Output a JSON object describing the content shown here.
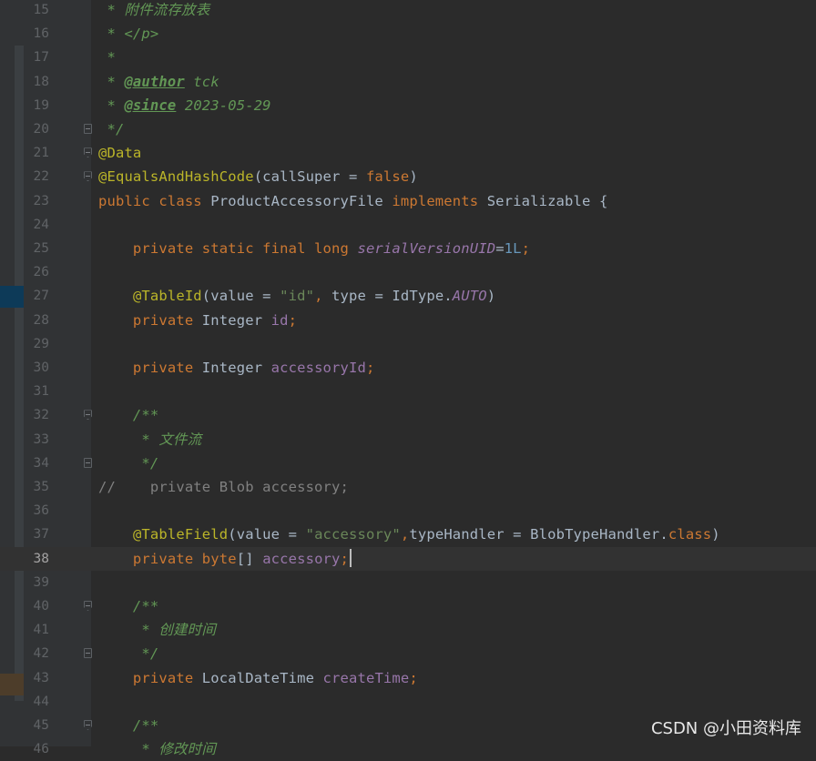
{
  "editor": {
    "watermark": "CSDN @小田资料库",
    "lines": [
      {
        "num": "15",
        "fold": "",
        "segs": [
          {
            "t": " * 附件流存放表",
            "c": "dc"
          }
        ]
      },
      {
        "num": "16",
        "fold": "",
        "segs": [
          {
            "t": " * </p>",
            "c": "dc"
          }
        ]
      },
      {
        "num": "17",
        "fold": "",
        "segs": [
          {
            "t": " *",
            "c": "dc"
          }
        ]
      },
      {
        "num": "18",
        "fold": "",
        "segs": [
          {
            "t": " * ",
            "c": "dc"
          },
          {
            "t": "@author",
            "c": "dt"
          },
          {
            "t": " tck",
            "c": "dc"
          }
        ]
      },
      {
        "num": "19",
        "fold": "",
        "segs": [
          {
            "t": " * ",
            "c": "dc"
          },
          {
            "t": "@since",
            "c": "dt"
          },
          {
            "t": " 2023-05-29",
            "c": "dc"
          }
        ]
      },
      {
        "num": "20",
        "fold": "end",
        "segs": [
          {
            "t": " */",
            "c": "dc"
          }
        ]
      },
      {
        "num": "21",
        "fold": "open",
        "segs": [
          {
            "t": "@Data",
            "c": "a"
          }
        ]
      },
      {
        "num": "22",
        "fold": "open",
        "segs": [
          {
            "t": "@EqualsAndHashCode",
            "c": "a"
          },
          {
            "t": "(callSuper = ",
            "c": ""
          },
          {
            "t": "false",
            "c": "k"
          },
          {
            "t": ")",
            "c": ""
          }
        ]
      },
      {
        "num": "23",
        "fold": "",
        "segs": [
          {
            "t": "public class ",
            "c": "k"
          },
          {
            "t": "ProductAccessoryFile ",
            "c": ""
          },
          {
            "t": "implements ",
            "c": "k"
          },
          {
            "t": "Serializable {",
            "c": ""
          }
        ]
      },
      {
        "num": "24",
        "fold": "",
        "segs": []
      },
      {
        "num": "25",
        "fold": "",
        "segs": [
          {
            "t": "    private static final long ",
            "c": "k"
          },
          {
            "t": "serialVersionUID",
            "c": "fi"
          },
          {
            "t": "=",
            "c": ""
          },
          {
            "t": "1L",
            "c": "n"
          },
          {
            "t": ";",
            "c": "k"
          }
        ]
      },
      {
        "num": "26",
        "fold": "",
        "segs": []
      },
      {
        "num": "27",
        "fold": "",
        "segs": [
          {
            "t": "    ",
            "c": ""
          },
          {
            "t": "@TableId",
            "c": "a"
          },
          {
            "t": "(value = ",
            "c": ""
          },
          {
            "t": "\"id\"",
            "c": "s"
          },
          {
            "t": ", ",
            "c": "k"
          },
          {
            "t": "type = IdType.",
            "c": ""
          },
          {
            "t": "AUTO",
            "c": "fi"
          },
          {
            "t": ")",
            "c": ""
          }
        ]
      },
      {
        "num": "28",
        "fold": "",
        "segs": [
          {
            "t": "    private ",
            "c": "k"
          },
          {
            "t": "Integer ",
            "c": ""
          },
          {
            "t": "id",
            "c": "f"
          },
          {
            "t": ";",
            "c": "k"
          }
        ]
      },
      {
        "num": "29",
        "fold": "",
        "segs": []
      },
      {
        "num": "30",
        "fold": "",
        "segs": [
          {
            "t": "    private ",
            "c": "k"
          },
          {
            "t": "Integer ",
            "c": ""
          },
          {
            "t": "accessoryId",
            "c": "f"
          },
          {
            "t": ";",
            "c": "k"
          }
        ]
      },
      {
        "num": "31",
        "fold": "",
        "segs": []
      },
      {
        "num": "32",
        "fold": "open",
        "segs": [
          {
            "t": "    /**",
            "c": "dc"
          }
        ]
      },
      {
        "num": "33",
        "fold": "",
        "segs": [
          {
            "t": "     * 文件流",
            "c": "dc"
          }
        ]
      },
      {
        "num": "34",
        "fold": "end",
        "segs": [
          {
            "t": "     */",
            "c": "dc"
          }
        ]
      },
      {
        "num": "35",
        "fold": "",
        "segs": [
          {
            "t": "//    private Blob accessory;",
            "c": "c"
          }
        ]
      },
      {
        "num": "36",
        "fold": "",
        "segs": []
      },
      {
        "num": "37",
        "fold": "",
        "segs": [
          {
            "t": "    ",
            "c": ""
          },
          {
            "t": "@TableField",
            "c": "a"
          },
          {
            "t": "(value = ",
            "c": ""
          },
          {
            "t": "\"accessory\"",
            "c": "s"
          },
          {
            "t": ",",
            "c": "k"
          },
          {
            "t": "typeHandler = BlobTypeHandler.",
            "c": ""
          },
          {
            "t": "class",
            "c": "k"
          },
          {
            "t": ")",
            "c": ""
          }
        ]
      },
      {
        "num": "38",
        "fold": "",
        "current": true,
        "segs": [
          {
            "t": "    private ",
            "c": "k"
          },
          {
            "t": "byte",
            "c": "k"
          },
          {
            "t": "[] ",
            "c": ""
          },
          {
            "t": "accessory",
            "c": "f"
          },
          {
            "t": ";",
            "c": "k"
          }
        ]
      },
      {
        "num": "39",
        "fold": "",
        "segs": []
      },
      {
        "num": "40",
        "fold": "open",
        "segs": [
          {
            "t": "    /**",
            "c": "dc"
          }
        ]
      },
      {
        "num": "41",
        "fold": "",
        "segs": [
          {
            "t": "     * 创建时间",
            "c": "dc"
          }
        ]
      },
      {
        "num": "42",
        "fold": "end",
        "segs": [
          {
            "t": "     */",
            "c": "dc"
          }
        ]
      },
      {
        "num": "43",
        "fold": "",
        "segs": [
          {
            "t": "    private ",
            "c": "k"
          },
          {
            "t": "LocalDateTime ",
            "c": ""
          },
          {
            "t": "createTime",
            "c": "f"
          },
          {
            "t": ";",
            "c": "k"
          }
        ]
      },
      {
        "num": "44",
        "fold": "",
        "segs": []
      },
      {
        "num": "45",
        "fold": "open",
        "segs": [
          {
            "t": "    /**",
            "c": "dc"
          }
        ]
      },
      {
        "num": "46",
        "fold": "",
        "segs": [
          {
            "t": "     * 修改时间",
            "c": "dc"
          }
        ]
      }
    ]
  },
  "colors": {
    "background": "#2b2b2b",
    "gutter": "#313335",
    "keyword": "#cc7832",
    "annotation": "#bbb529",
    "field": "#9876aa",
    "string": "#6a8759",
    "number": "#6897bb",
    "doc_comment": "#629755",
    "comment": "#808080",
    "marker_blue": "#0d3a58",
    "marker_brown": "#4d3d2a"
  }
}
